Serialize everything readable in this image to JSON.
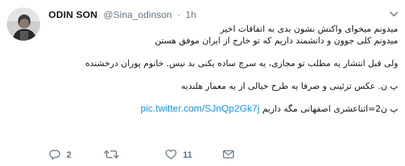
{
  "tweet": {
    "display_name": "ODIN SON",
    "handle": "@Sina_odinson",
    "separator": "·",
    "time": "1h",
    "lines": [
      "میدونم میخوای واکنش نشون بدی به اتفاقات اخیر",
      "میدونم کلی جوون و دانشمند داریم که تو خارج از ایران موفق هستن",
      "ولی قبل انتشار یه مطلب تو مجازی، یه سرچ ساده بکنی بد نیس. خانوم پوران درخشنده",
      "پ ن. عکس تزئینی و صرفا یه طرح خیالی از یه معمار هلندیه",
      "پ ن2=اثناعشری اصفهانی مگه داریم"
    ],
    "link": "pic.twitter.com/SJnQp2Gk7j"
  },
  "actions": {
    "reply_count": "2",
    "retweet_count": "",
    "like_count": "11"
  },
  "colors": {
    "text": "#14171a",
    "muted": "#657786",
    "link": "#1b95e0"
  },
  "icons": {
    "avatar": "profile-photo",
    "caret": "chevron-down-icon",
    "reply": "reply-icon",
    "retweet": "retweet-icon",
    "like": "heart-icon",
    "dm": "envelope-icon"
  }
}
